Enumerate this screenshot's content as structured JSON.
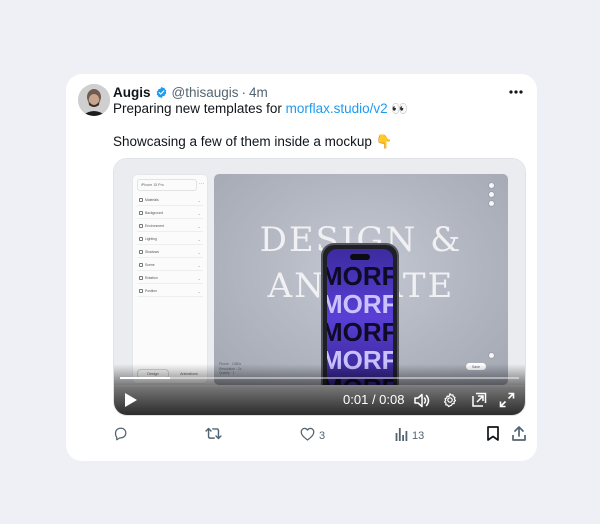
{
  "author": {
    "name": "Augis",
    "handle": "@thisaugis",
    "time": "4m"
  },
  "tweet": {
    "line1_prefix": "Preparing new templates for ",
    "link": "morflax.studio/v2",
    "line1_suffix": " 👀",
    "line2": "Showcasing a few of them inside a mockup 👇"
  },
  "mockup": {
    "panel_title": "iPhone 15 Pro",
    "panel_rows": [
      "Materials",
      "Background",
      "Environment",
      "Lighting",
      "Shadows",
      "Scene",
      "Rotation",
      "Position"
    ],
    "panel_tabs": [
      "Design",
      "Animations"
    ],
    "stage_line1": "DESIGN &",
    "stage_line2": "ANIMATE",
    "phone_word": "MORFLAX",
    "stage_info": [
      "Phone · 1080x",
      "Resolution · 2x",
      "Quality · 1"
    ],
    "stage_pill": "Save"
  },
  "video": {
    "current": "0:01",
    "total": "0:08",
    "progress": 0.125
  },
  "metrics": {
    "reply": "",
    "repost": "",
    "like": "3",
    "views": "13"
  },
  "colors": {
    "accent": "#1d9bf0",
    "text": "#0f1419",
    "muted": "#536471",
    "page_bg": "#eef0f5"
  }
}
